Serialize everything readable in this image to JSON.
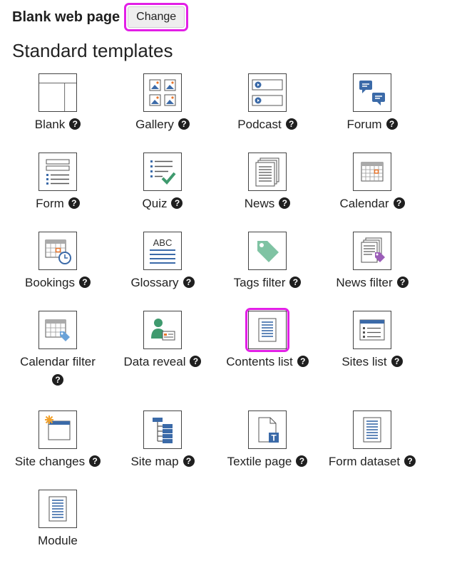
{
  "header": {
    "title": "Blank web page",
    "change_label": "Change"
  },
  "section": {
    "title": "Standard templates"
  },
  "help_symbol": "?",
  "templates": [
    {
      "label": "Blank",
      "icon": "blank-layout-icon"
    },
    {
      "label": "Gallery",
      "icon": "gallery-icon"
    },
    {
      "label": "Podcast",
      "icon": "podcast-icon"
    },
    {
      "label": "Forum",
      "icon": "forum-icon"
    },
    {
      "label": "Form",
      "icon": "form-icon"
    },
    {
      "label": "Quiz",
      "icon": "quiz-icon"
    },
    {
      "label": "News",
      "icon": "news-icon"
    },
    {
      "label": "Calendar",
      "icon": "calendar-icon"
    },
    {
      "label": "Bookings",
      "icon": "bookings-icon"
    },
    {
      "label": "Glossary",
      "icon": "glossary-icon"
    },
    {
      "label": "Tags filter",
      "icon": "tag-icon"
    },
    {
      "label": "News filter",
      "icon": "news-filter-icon"
    },
    {
      "label": "Calendar filter",
      "icon": "calendar-filter-icon"
    },
    {
      "label": "Data reveal",
      "icon": "data-reveal-icon"
    },
    {
      "label": "Contents list",
      "icon": "contents-list-icon"
    },
    {
      "label": "Sites list",
      "icon": "sites-list-icon"
    },
    {
      "label": "Site changes",
      "icon": "site-changes-icon"
    },
    {
      "label": "Site map",
      "icon": "site-map-icon"
    },
    {
      "label": "Textile page",
      "icon": "textile-page-icon"
    },
    {
      "label": "Form dataset",
      "icon": "form-dataset-icon"
    },
    {
      "label": "Module",
      "icon": "module-icon"
    }
  ],
  "colors": {
    "highlight": "#e21fe6",
    "icon_blue": "#3b6aa8",
    "icon_orange": "#e8742a",
    "icon_green": "#3f9a6e"
  }
}
